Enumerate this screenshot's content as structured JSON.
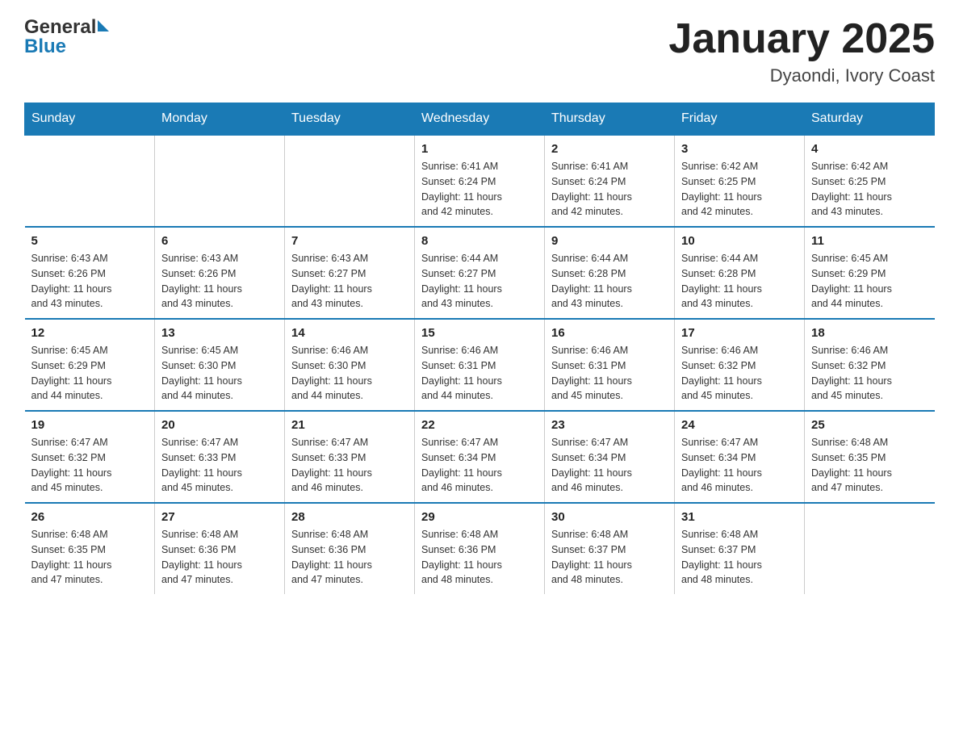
{
  "header": {
    "logo_text_general": "General",
    "logo_text_blue": "Blue",
    "calendar_title": "January 2025",
    "calendar_subtitle": "Dyaondi, Ivory Coast"
  },
  "days_of_week": [
    "Sunday",
    "Monday",
    "Tuesday",
    "Wednesday",
    "Thursday",
    "Friday",
    "Saturday"
  ],
  "weeks": [
    [
      {
        "day": "",
        "info": ""
      },
      {
        "day": "",
        "info": ""
      },
      {
        "day": "",
        "info": ""
      },
      {
        "day": "1",
        "info": "Sunrise: 6:41 AM\nSunset: 6:24 PM\nDaylight: 11 hours\nand 42 minutes."
      },
      {
        "day": "2",
        "info": "Sunrise: 6:41 AM\nSunset: 6:24 PM\nDaylight: 11 hours\nand 42 minutes."
      },
      {
        "day": "3",
        "info": "Sunrise: 6:42 AM\nSunset: 6:25 PM\nDaylight: 11 hours\nand 42 minutes."
      },
      {
        "day": "4",
        "info": "Sunrise: 6:42 AM\nSunset: 6:25 PM\nDaylight: 11 hours\nand 43 minutes."
      }
    ],
    [
      {
        "day": "5",
        "info": "Sunrise: 6:43 AM\nSunset: 6:26 PM\nDaylight: 11 hours\nand 43 minutes."
      },
      {
        "day": "6",
        "info": "Sunrise: 6:43 AM\nSunset: 6:26 PM\nDaylight: 11 hours\nand 43 minutes."
      },
      {
        "day": "7",
        "info": "Sunrise: 6:43 AM\nSunset: 6:27 PM\nDaylight: 11 hours\nand 43 minutes."
      },
      {
        "day": "8",
        "info": "Sunrise: 6:44 AM\nSunset: 6:27 PM\nDaylight: 11 hours\nand 43 minutes."
      },
      {
        "day": "9",
        "info": "Sunrise: 6:44 AM\nSunset: 6:28 PM\nDaylight: 11 hours\nand 43 minutes."
      },
      {
        "day": "10",
        "info": "Sunrise: 6:44 AM\nSunset: 6:28 PM\nDaylight: 11 hours\nand 43 minutes."
      },
      {
        "day": "11",
        "info": "Sunrise: 6:45 AM\nSunset: 6:29 PM\nDaylight: 11 hours\nand 44 minutes."
      }
    ],
    [
      {
        "day": "12",
        "info": "Sunrise: 6:45 AM\nSunset: 6:29 PM\nDaylight: 11 hours\nand 44 minutes."
      },
      {
        "day": "13",
        "info": "Sunrise: 6:45 AM\nSunset: 6:30 PM\nDaylight: 11 hours\nand 44 minutes."
      },
      {
        "day": "14",
        "info": "Sunrise: 6:46 AM\nSunset: 6:30 PM\nDaylight: 11 hours\nand 44 minutes."
      },
      {
        "day": "15",
        "info": "Sunrise: 6:46 AM\nSunset: 6:31 PM\nDaylight: 11 hours\nand 44 minutes."
      },
      {
        "day": "16",
        "info": "Sunrise: 6:46 AM\nSunset: 6:31 PM\nDaylight: 11 hours\nand 45 minutes."
      },
      {
        "day": "17",
        "info": "Sunrise: 6:46 AM\nSunset: 6:32 PM\nDaylight: 11 hours\nand 45 minutes."
      },
      {
        "day": "18",
        "info": "Sunrise: 6:46 AM\nSunset: 6:32 PM\nDaylight: 11 hours\nand 45 minutes."
      }
    ],
    [
      {
        "day": "19",
        "info": "Sunrise: 6:47 AM\nSunset: 6:32 PM\nDaylight: 11 hours\nand 45 minutes."
      },
      {
        "day": "20",
        "info": "Sunrise: 6:47 AM\nSunset: 6:33 PM\nDaylight: 11 hours\nand 45 minutes."
      },
      {
        "day": "21",
        "info": "Sunrise: 6:47 AM\nSunset: 6:33 PM\nDaylight: 11 hours\nand 46 minutes."
      },
      {
        "day": "22",
        "info": "Sunrise: 6:47 AM\nSunset: 6:34 PM\nDaylight: 11 hours\nand 46 minutes."
      },
      {
        "day": "23",
        "info": "Sunrise: 6:47 AM\nSunset: 6:34 PM\nDaylight: 11 hours\nand 46 minutes."
      },
      {
        "day": "24",
        "info": "Sunrise: 6:47 AM\nSunset: 6:34 PM\nDaylight: 11 hours\nand 46 minutes."
      },
      {
        "day": "25",
        "info": "Sunrise: 6:48 AM\nSunset: 6:35 PM\nDaylight: 11 hours\nand 47 minutes."
      }
    ],
    [
      {
        "day": "26",
        "info": "Sunrise: 6:48 AM\nSunset: 6:35 PM\nDaylight: 11 hours\nand 47 minutes."
      },
      {
        "day": "27",
        "info": "Sunrise: 6:48 AM\nSunset: 6:36 PM\nDaylight: 11 hours\nand 47 minutes."
      },
      {
        "day": "28",
        "info": "Sunrise: 6:48 AM\nSunset: 6:36 PM\nDaylight: 11 hours\nand 47 minutes."
      },
      {
        "day": "29",
        "info": "Sunrise: 6:48 AM\nSunset: 6:36 PM\nDaylight: 11 hours\nand 48 minutes."
      },
      {
        "day": "30",
        "info": "Sunrise: 6:48 AM\nSunset: 6:37 PM\nDaylight: 11 hours\nand 48 minutes."
      },
      {
        "day": "31",
        "info": "Sunrise: 6:48 AM\nSunset: 6:37 PM\nDaylight: 11 hours\nand 48 minutes."
      },
      {
        "day": "",
        "info": ""
      }
    ]
  ]
}
